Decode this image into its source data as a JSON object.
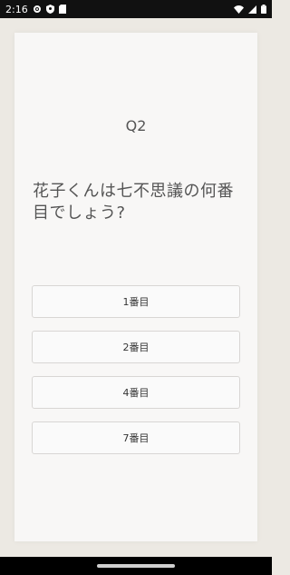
{
  "status_bar": {
    "time": "2:16",
    "left_icons": [
      "gear-icon",
      "shield-icon",
      "sim-card-icon"
    ],
    "right_icons": [
      "wifi-icon",
      "signal-icon",
      "battery-icon"
    ]
  },
  "quiz": {
    "question_number": "Q2",
    "question_text": "花子くんは七不思議の何番目でしょう?",
    "answers": [
      {
        "label": "1番目"
      },
      {
        "label": "2番目"
      },
      {
        "label": "4番目"
      },
      {
        "label": "7番目"
      }
    ]
  },
  "colors": {
    "background": "#ece9e3",
    "card": "#f8f7f6",
    "status_bar": "#111111"
  }
}
